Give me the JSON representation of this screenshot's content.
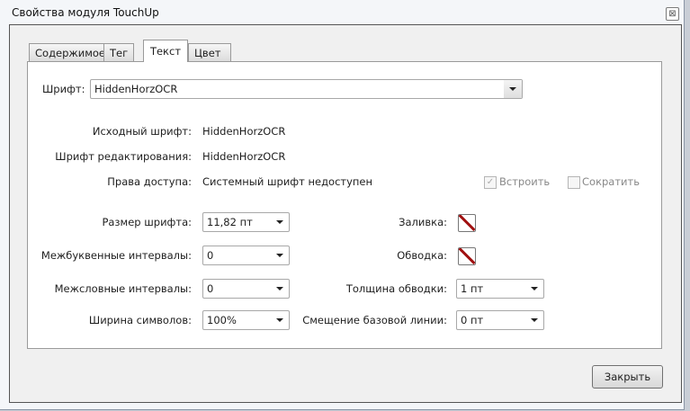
{
  "window": {
    "title": "Свойства модуля TouchUp",
    "close_glyph": "⊠"
  },
  "tabs": [
    "Содержимое",
    "Тег",
    "Текст",
    "Цвет"
  ],
  "font": {
    "label": "Шрифт:",
    "value": "HiddenHorzOCR"
  },
  "info": [
    {
      "label": "Исходный шрифт:",
      "value": "HiddenHorzOCR"
    },
    {
      "label": "Шрифт редактирования:",
      "value": "HiddenHorzOCR"
    },
    {
      "label": "Права доступа:",
      "value": "Системный шрифт недоступен"
    }
  ],
  "checkboxes": [
    {
      "label": "Встроить",
      "checked": true,
      "mark": "✓"
    },
    {
      "label": "Сократить",
      "checked": false,
      "mark": ""
    }
  ],
  "left_fields": [
    {
      "label": "Размер шрифта:",
      "value": "11,82 пт"
    },
    {
      "label": "Межбуквенные интервалы:",
      "value": "0"
    },
    {
      "label": "Межсловные интервалы:",
      "value": "0"
    },
    {
      "label": "Ширина символов:",
      "value": "100%"
    }
  ],
  "fill": {
    "label": "Заливка:"
  },
  "stroke": {
    "label": "Обводка:"
  },
  "stroke_width": {
    "label": "Толщина обводки:",
    "value": "1 пт"
  },
  "baseline": {
    "label": "Смещение базовой линии:",
    "value": "0 пт"
  },
  "close_button": "Закрыть"
}
